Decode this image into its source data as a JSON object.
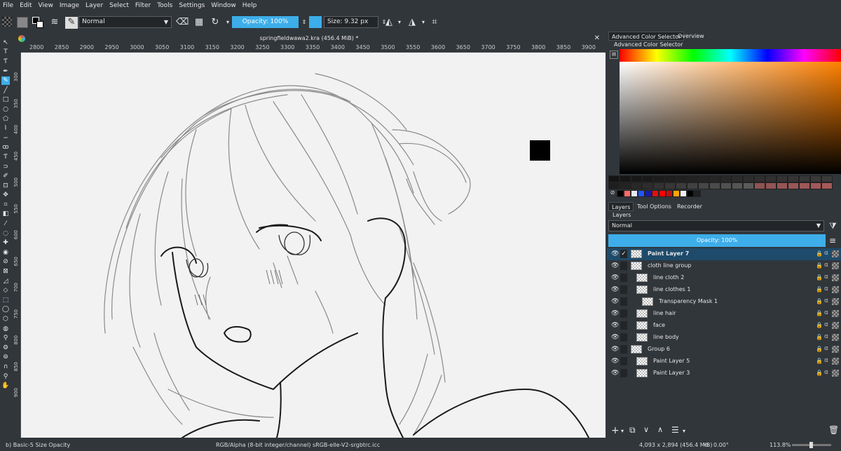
{
  "menu": [
    "File",
    "Edit",
    "View",
    "Image",
    "Layer",
    "Select",
    "Filter",
    "Tools",
    "Settings",
    "Window",
    "Help"
  ],
  "toolbar": {
    "blend_mode": "Normal",
    "opacity": "Opacity: 100%",
    "size": "Size: 9.32 px"
  },
  "document": {
    "tab_title": "springfieldwawa2.kra (456.4 MiB) *",
    "close": "✕"
  },
  "ruler": {
    "h_ticks": [
      "2800",
      "2850",
      "2900",
      "2950",
      "3000",
      "3050",
      "3100",
      "3150",
      "3200",
      "3250",
      "3300",
      "3350",
      "3400",
      "3450",
      "3500",
      "3550",
      "3600",
      "3650",
      "3700",
      "3750",
      "3800",
      "3850",
      "3900"
    ],
    "v_ticks": [
      "300",
      "350",
      "400",
      "450",
      "500",
      "550",
      "600",
      "650",
      "700",
      "750",
      "800",
      "850",
      "900"
    ]
  },
  "panels": {
    "tabs": [
      "Advanced Color Selector",
      "Overview"
    ],
    "color_selector_title": "Advanced Color Selector",
    "bottom_tabs": [
      "Layers",
      "Tool Options",
      "Recorder"
    ],
    "layers_title": "Layers",
    "layers_blend": "Normal",
    "layers_opacity": "Opacity:  100%"
  },
  "recent_colors": [
    "#000000",
    "#ff6b6b",
    "#e8e8f0",
    "#2255ff",
    "#1a1aa0",
    "#e01010",
    "#ff0000",
    "#c01010",
    "#ffa500",
    "#f0f0f0",
    "#000000",
    "#202020"
  ],
  "layers": [
    {
      "name": "Paint Layer 7",
      "selected": true,
      "indent": 0
    },
    {
      "name": "cloth line group",
      "selected": false,
      "indent": 0
    },
    {
      "name": "line cloth 2",
      "selected": false,
      "indent": 1
    },
    {
      "name": "line clothes 1",
      "selected": false,
      "indent": 1
    },
    {
      "name": "Transparency Mask 1",
      "selected": false,
      "indent": 2
    },
    {
      "name": "line hair",
      "selected": false,
      "indent": 1
    },
    {
      "name": "face",
      "selected": false,
      "indent": 1
    },
    {
      "name": "line body",
      "selected": false,
      "indent": 1
    },
    {
      "name": "Group 6",
      "selected": false,
      "indent": 0
    },
    {
      "name": "Paint Layer 5",
      "selected": false,
      "indent": 1
    },
    {
      "name": "Paint Layer 3",
      "selected": false,
      "indent": 1
    }
  ],
  "status": {
    "brush": "b) Basic-5 Size Opacity",
    "colorspace": "RGB/Alpha (8-bit integer/channel)  sRGB-elle-V2-srgbtrc.icc",
    "dimensions": "4,093 x 2,894 (456.4 MiB)",
    "rotation": "0.00°",
    "zoom": "113.8%"
  },
  "colors": {
    "accent": "#3daee9",
    "bg": "#31363b",
    "canvas": "#f2f2f2"
  }
}
